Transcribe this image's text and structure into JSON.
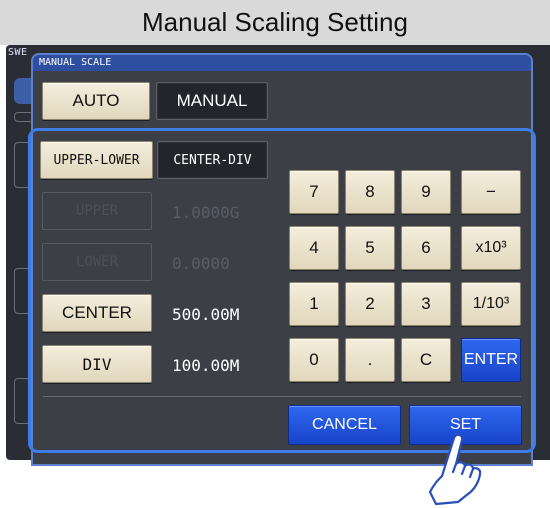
{
  "banner": {
    "title": "Manual Scaling Setting"
  },
  "background": {
    "tag_text": "SWE"
  },
  "dialog": {
    "title": "MANUAL SCALE"
  },
  "mode": {
    "auto_label": "AUTO",
    "manual_label": "MANUAL",
    "selected": "MANUAL"
  },
  "range_mode": {
    "upper_lower_label": "UPPER-LOWER",
    "center_div_label": "CENTER-DIV",
    "selected": "CENTER-DIV"
  },
  "fields": {
    "upper": {
      "label": "UPPER",
      "value": "1.0000G",
      "enabled": false
    },
    "lower": {
      "label": "LOWER",
      "value": "0.0000",
      "enabled": false
    },
    "center": {
      "label": "CENTER",
      "value": "500.00M",
      "enabled": true
    },
    "div": {
      "label": "DIV",
      "value": "100.00M",
      "enabled": true
    }
  },
  "keypad": {
    "k7": "7",
    "k8": "8",
    "k9": "9",
    "minus": "−",
    "k4": "4",
    "k5": "5",
    "k6": "6",
    "x1000": "x10³",
    "k1": "1",
    "k2": "2",
    "k3": "3",
    "div1000": "1/10³",
    "k0": "0",
    "dot": ".",
    "clear": "C",
    "enter": "ENTER"
  },
  "footer": {
    "cancel_label": "CANCEL",
    "set_label": "SET"
  },
  "colors": {
    "accent_blue": "#1744c8",
    "frame_blue": "#3e7ce8",
    "key_face": "#e9dfc6",
    "dialog_bg": "#3c3f46"
  },
  "icons": {
    "pointer": "pointing-hand-icon"
  }
}
